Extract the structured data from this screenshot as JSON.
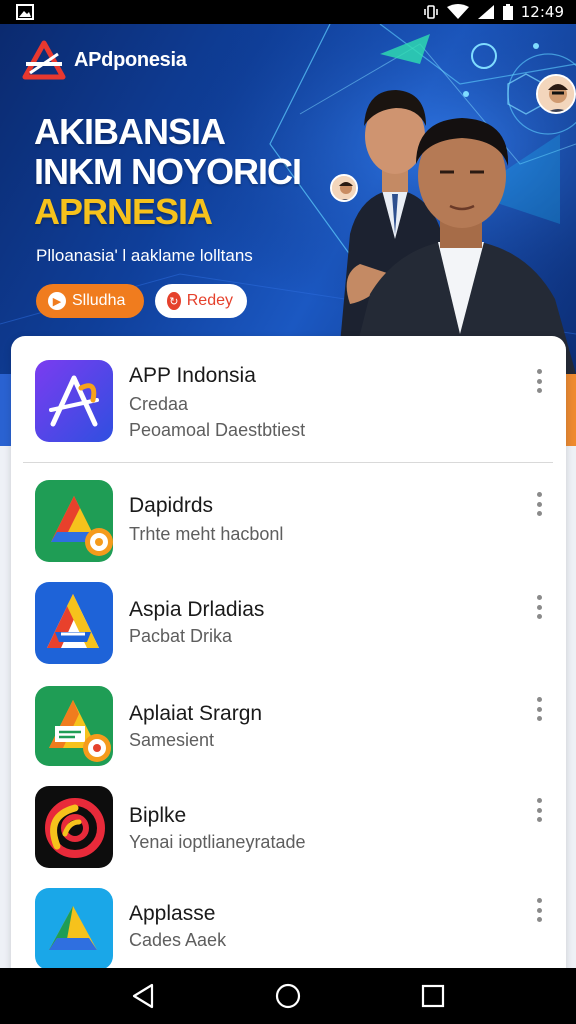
{
  "status_bar": {
    "time": "12:49",
    "icons": [
      "image-icon",
      "vibrate-icon",
      "wifi-icon",
      "signal-icon",
      "battery-icon"
    ]
  },
  "hero": {
    "brand_name": "APdponesia",
    "headline_1": "AKIBANSIA",
    "headline_2": "INKM NOYORICI",
    "headline_3": "APRNESIA",
    "tagline": "Plloanasia' l aaklame lolltans",
    "button_primary": "Slludha",
    "button_secondary": "Redey",
    "colors": {
      "accent": "#f6c21c",
      "primary_button": "#f07c1e",
      "secondary_text": "#e5412c"
    }
  },
  "apps": [
    {
      "title": "APP Indonsia",
      "subtitle": "Credaa",
      "detail": "Peoamoal Daestbtiest",
      "icon": "app-indonesia-icon"
    },
    {
      "title": "Dapidrds",
      "subtitle": "Trhte meht hacbonl",
      "icon": "dapidrds-icon"
    },
    {
      "title": "Aspia Drladias",
      "subtitle": "Pacbat Drika",
      "icon": "aspia-icon"
    },
    {
      "title": "Aplaiat Srargn",
      "subtitle": "Samesient",
      "icon": "aplaiat-icon"
    },
    {
      "title": "Biplke",
      "subtitle": "Yenai ioptlianeyratade",
      "icon": "biplke-icon"
    },
    {
      "title": "Applasse",
      "subtitle": "Cades Aaek",
      "icon": "applasse-icon"
    }
  ],
  "nav": [
    "back-icon",
    "home-icon",
    "recents-icon"
  ]
}
